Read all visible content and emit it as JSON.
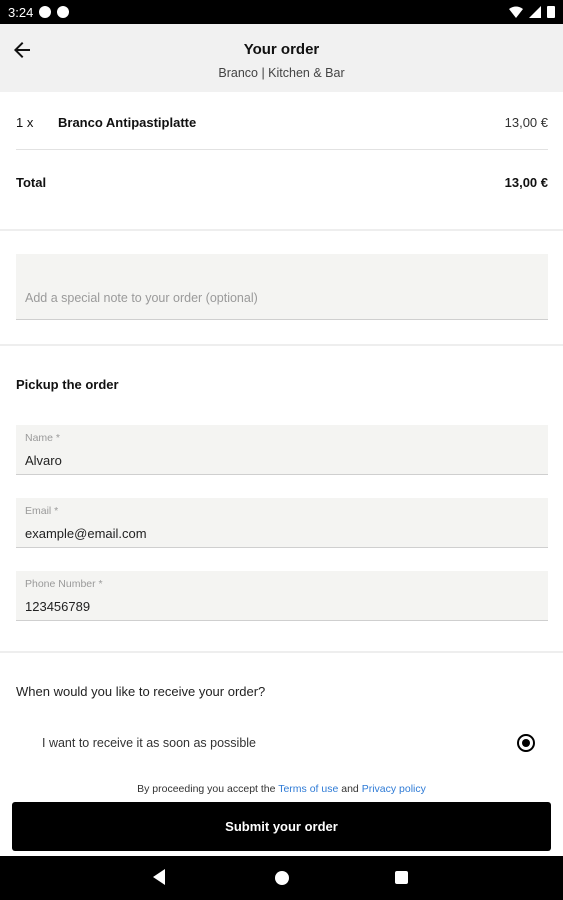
{
  "status_bar": {
    "time": "3:24"
  },
  "header": {
    "title": "Your order",
    "subtitle": "Branco | Kitchen & Bar"
  },
  "order": {
    "items": [
      {
        "qty": "1 x",
        "name": "Branco Antipastiplatte",
        "price": "13,00 €"
      }
    ],
    "total_label": "Total",
    "total_value": "13,00 €"
  },
  "note": {
    "placeholder": "Add a special note to your order (optional)"
  },
  "pickup": {
    "title": "Pickup the order",
    "fields": [
      {
        "label": "Name *",
        "value": "Alvaro"
      },
      {
        "label": "Email *",
        "value": "example@email.com"
      },
      {
        "label": "Phone Number *",
        "value": "123456789"
      }
    ]
  },
  "timing": {
    "question": "When would you like to receive your order?",
    "option": "I want to receive it as soon as possible"
  },
  "terms": {
    "prefix": "By proceeding you accept the",
    "terms_link": "Terms of use",
    "and": "and",
    "privacy_link": "Privacy policy"
  },
  "submit_label": "Submit your order"
}
